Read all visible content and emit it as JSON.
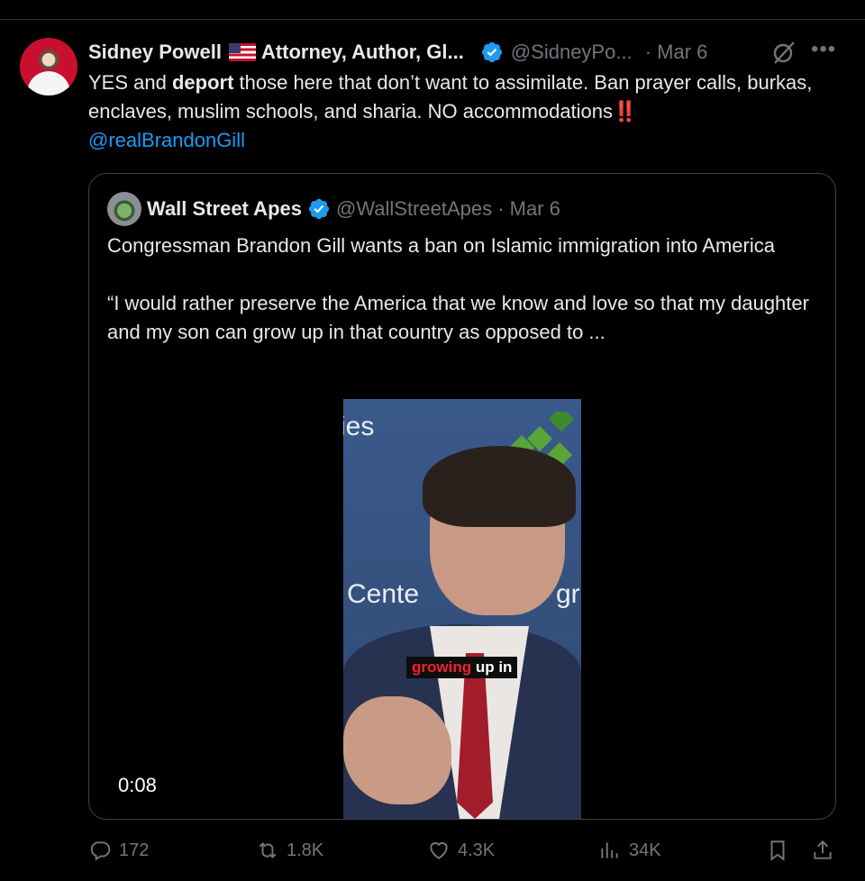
{
  "tweet": {
    "author_name": "Sidney Powell",
    "author_title": "Attorney, Author, Gl...",
    "handle": "@SidneyPo...",
    "date": "· Mar 6",
    "text_parts": {
      "t1": "YES and ",
      "t2": "deport",
      "t3": " those here that don’t want to assimilate. Ban prayer calls, burkas, enclaves, muslim schools, and sharia. NO accommodations",
      "bangs": "‼️",
      "mention": "@realBrandonGill"
    }
  },
  "quote": {
    "author_name": "Wall Street Apes",
    "handle": "@WallStreetApes · Mar 6",
    "text": "Congressman Brandon Gill wants a ban on Islamic immigration into America\n\n“I would rather preserve the America that we know and love so that my daughter and my son can grow up in that country as opposed to ...",
    "video": {
      "bg_text_1": "ies",
      "bg_text_2": "Cente",
      "bg_text_3": "gra",
      "caption_red": "growing",
      "caption_white": " up in",
      "timer": "0:08"
    }
  },
  "actions": {
    "replies": "172",
    "reposts": "1.8K",
    "likes": "4.3K",
    "views": "34K"
  },
  "colors": {
    "background": "#000000",
    "text": "#e7e9ea",
    "muted": "#71767b",
    "link": "#1d9bf0",
    "verified": "#1d9bf0"
  },
  "icons": [
    "verified-badge-icon",
    "grok-icon",
    "more-icon",
    "reply-icon",
    "repost-icon",
    "like-icon",
    "views-icon",
    "bookmark-icon",
    "share-icon"
  ]
}
